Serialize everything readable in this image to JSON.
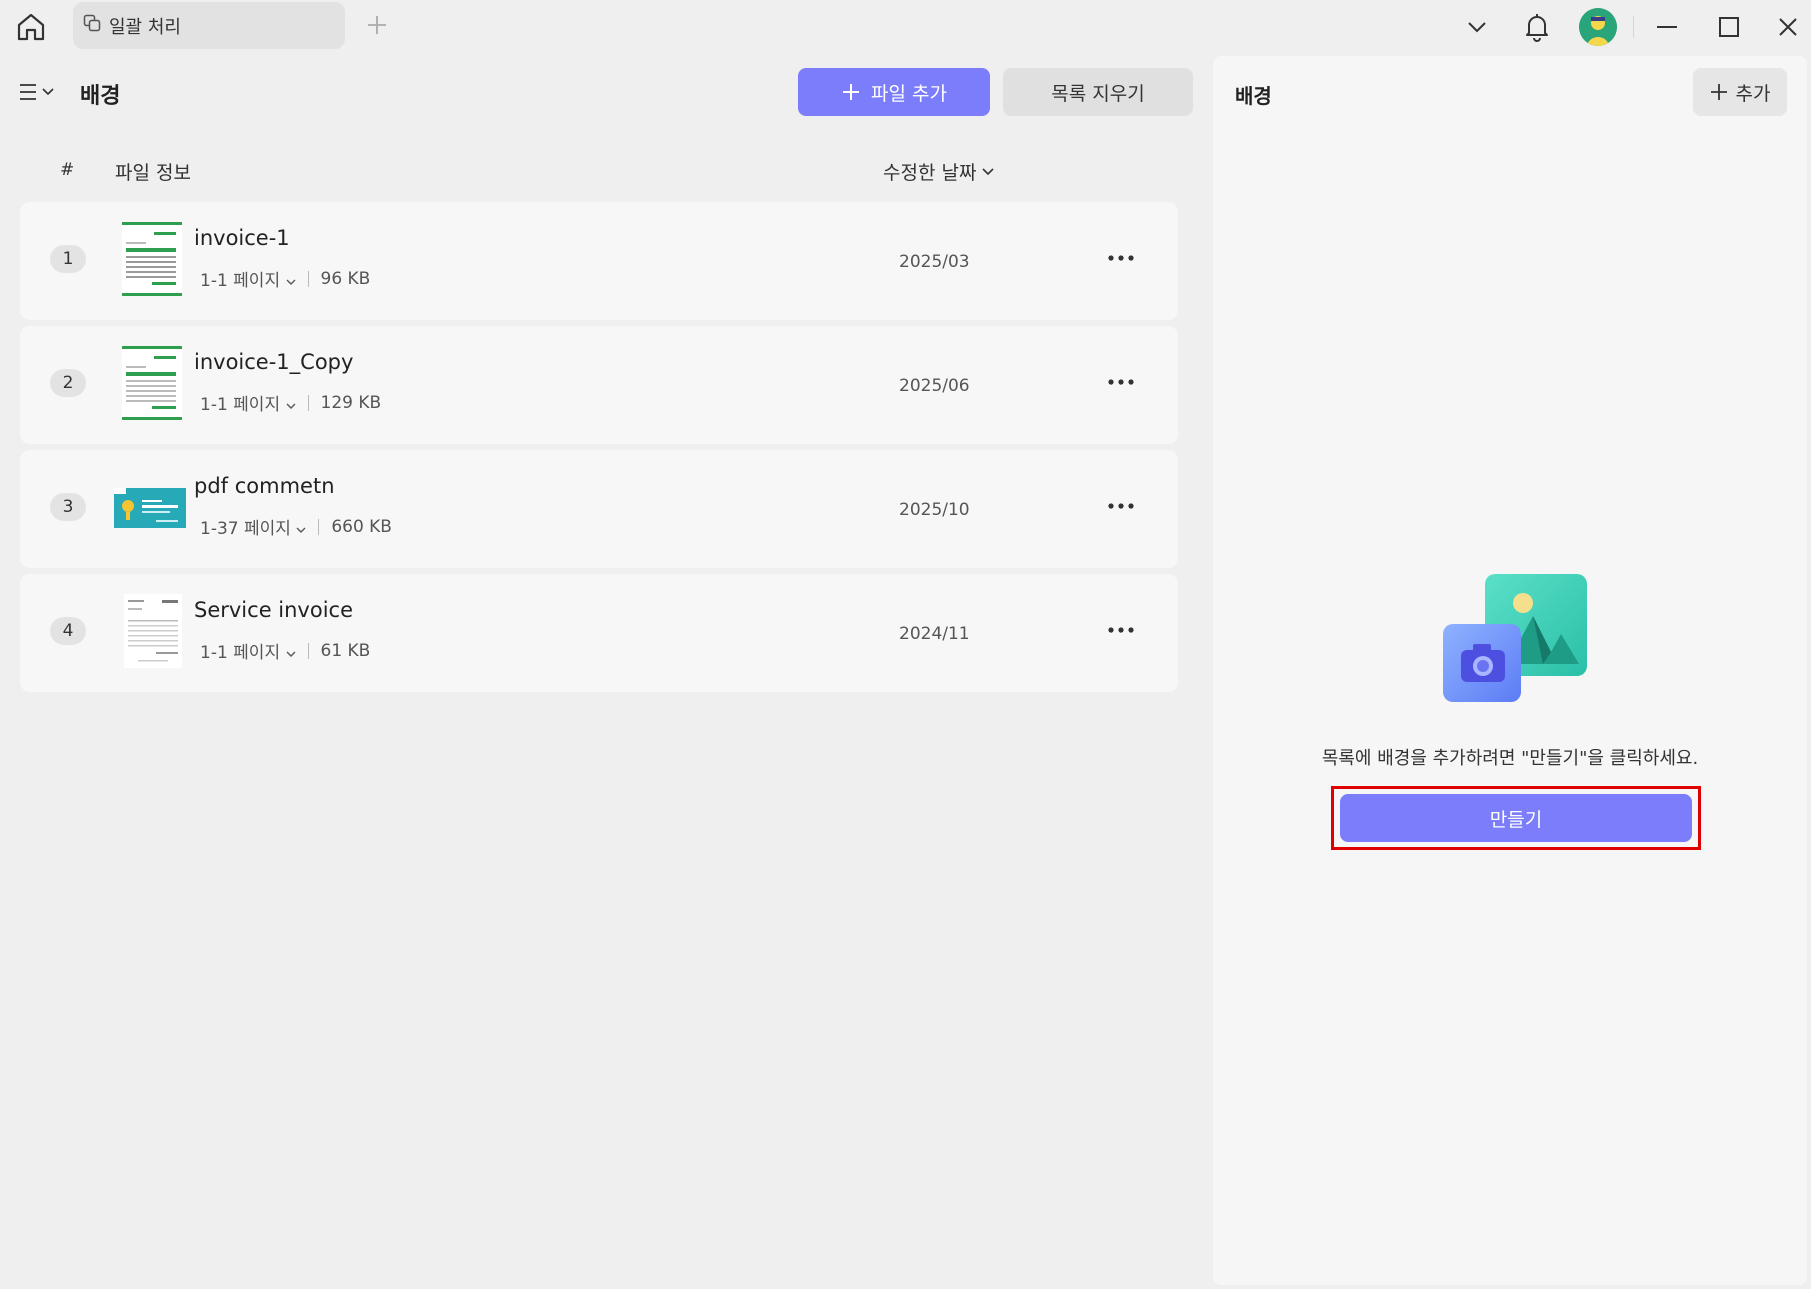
{
  "titlebar": {
    "tab_label": "일괄 처리"
  },
  "left": {
    "title": "배경",
    "add_file_label": "파일 추가",
    "clear_list_label": "목록 지우기",
    "columns": {
      "hash": "#",
      "info": "파일 정보",
      "date": "수정한 날짜"
    },
    "files": [
      {
        "num": "1",
        "name": "invoice-1",
        "pages": "1-1 페이지",
        "size": "96 KB",
        "date": "2025/03"
      },
      {
        "num": "2",
        "name": "invoice-1_Copy",
        "pages": "1-1 페이지",
        "size": "129 KB",
        "date": "2025/06"
      },
      {
        "num": "3",
        "name": "pdf commetn",
        "pages": "1-37 페이지",
        "size": "660 KB",
        "date": "2025/10"
      },
      {
        "num": "4",
        "name": "Service invoice",
        "pages": "1-1 페이지",
        "size": "61 KB",
        "date": "2024/11"
      }
    ]
  },
  "right": {
    "title": "배경",
    "add_label": "추가",
    "hint": "목록에 배경을 추가하려면 \"만들기\"을 클릭하세요.",
    "create_label": "만들기"
  },
  "colors": {
    "accent": "#7b7dfa",
    "highlight_border": "#e00000",
    "invoice_green": "#2e9e4f",
    "teal_thumb": "#27a9b8"
  }
}
